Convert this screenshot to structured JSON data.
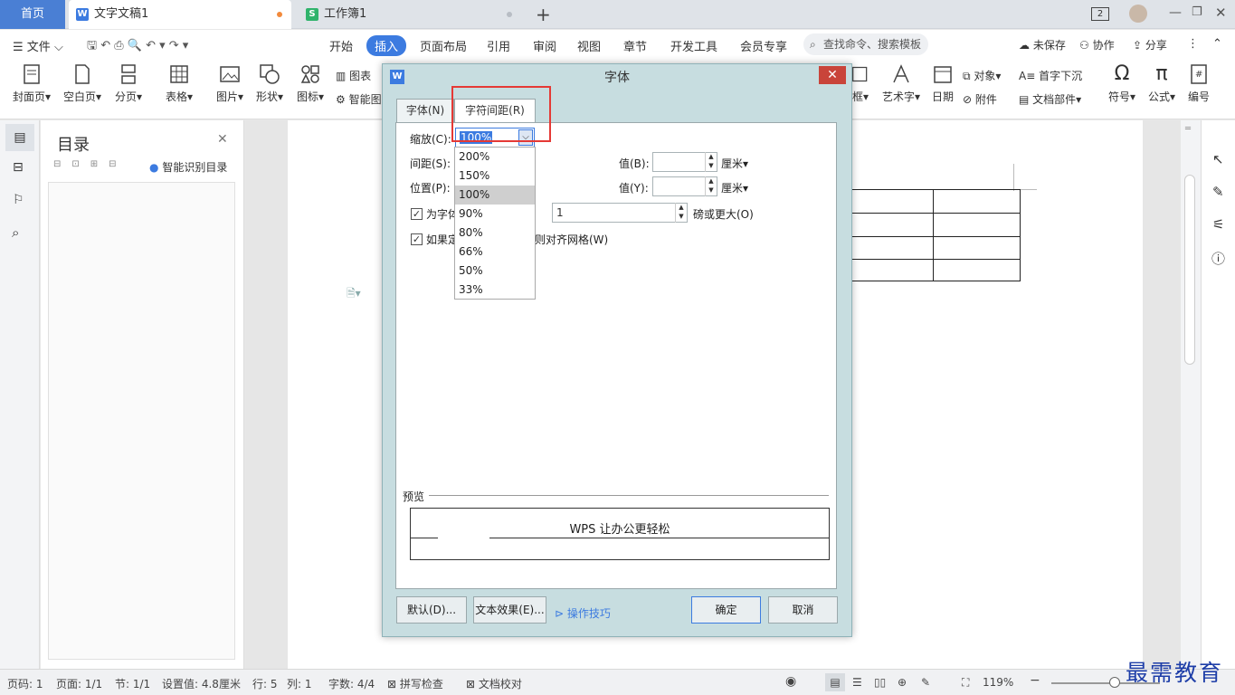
{
  "tabs": {
    "home": "首页",
    "doc": "文字文稿1",
    "sheet": "工作簿1",
    "doc_icon": "W",
    "sheet_icon": "S",
    "window_count": "2"
  },
  "commandbar": {
    "file": "文件",
    "menus": [
      "开始",
      "插入",
      "页面布局",
      "引用",
      "审阅",
      "视图",
      "章节",
      "开发工具",
      "会员专享"
    ],
    "search_placeholder": "查找命令、搜索模板",
    "unsaved": "未保存",
    "collab": "协作",
    "share": "分享"
  },
  "ribbon": {
    "buttons": [
      "封面页",
      "空白页",
      "分页",
      "表格",
      "图片",
      "形状",
      "图标"
    ],
    "small_left": [
      "图表",
      "智能图"
    ],
    "right_buttons": [
      "框",
      "艺术字",
      "日期"
    ],
    "small_right": [
      "对象",
      "附件",
      "首字下沉",
      "文档部件"
    ],
    "far_right": [
      "符号",
      "公式",
      "编号"
    ]
  },
  "navpanel": {
    "title": "目录",
    "smart": "智能识别目录"
  },
  "dialog": {
    "title": "字体",
    "tab_font": "字体(N)",
    "tab_spacing": "字符间距(R)",
    "scale_label": "缩放(C):",
    "scale_value": "100%",
    "spacing_label": "间距(S):",
    "position_label": "位置(P):",
    "value_b_label": "值(B):",
    "value_y_label": "值(Y):",
    "unit1": "厘米",
    "unit2": "厘米",
    "kerning_label": "为字体",
    "kerning_value": "1",
    "kerning_suffix": "磅或更大(O)",
    "grid_label_a": "如果定",
    "grid_label_b": "则对齐网格(W)",
    "preview_label": "预览",
    "preview_text": "WPS 让办公更轻松",
    "default_btn": "默认(D)...",
    "effects_btn": "文本效果(E)...",
    "tips_link": "操作技巧",
    "ok_btn": "确定",
    "cancel_btn": "取消"
  },
  "dropdown_options": [
    "200%",
    "150%",
    "100%",
    "90%",
    "80%",
    "66%",
    "50%",
    "33%"
  ],
  "dropdown_selected": "100%",
  "statusbar": {
    "page": "页码: 1",
    "pages": "页面: 1/1",
    "section": "节: 1/1",
    "setting": "设置值: 4.8厘米",
    "row": "行: 5",
    "col": "列: 1",
    "words": "字数: 4/4",
    "spell": "拼写检查",
    "proof": "文档校对",
    "zoom": "119%"
  },
  "watermark": "最需教育",
  "colors": {
    "accent": "#3c7be0",
    "highlight": "#e53935",
    "dialog_bg": "#c7dde0"
  }
}
